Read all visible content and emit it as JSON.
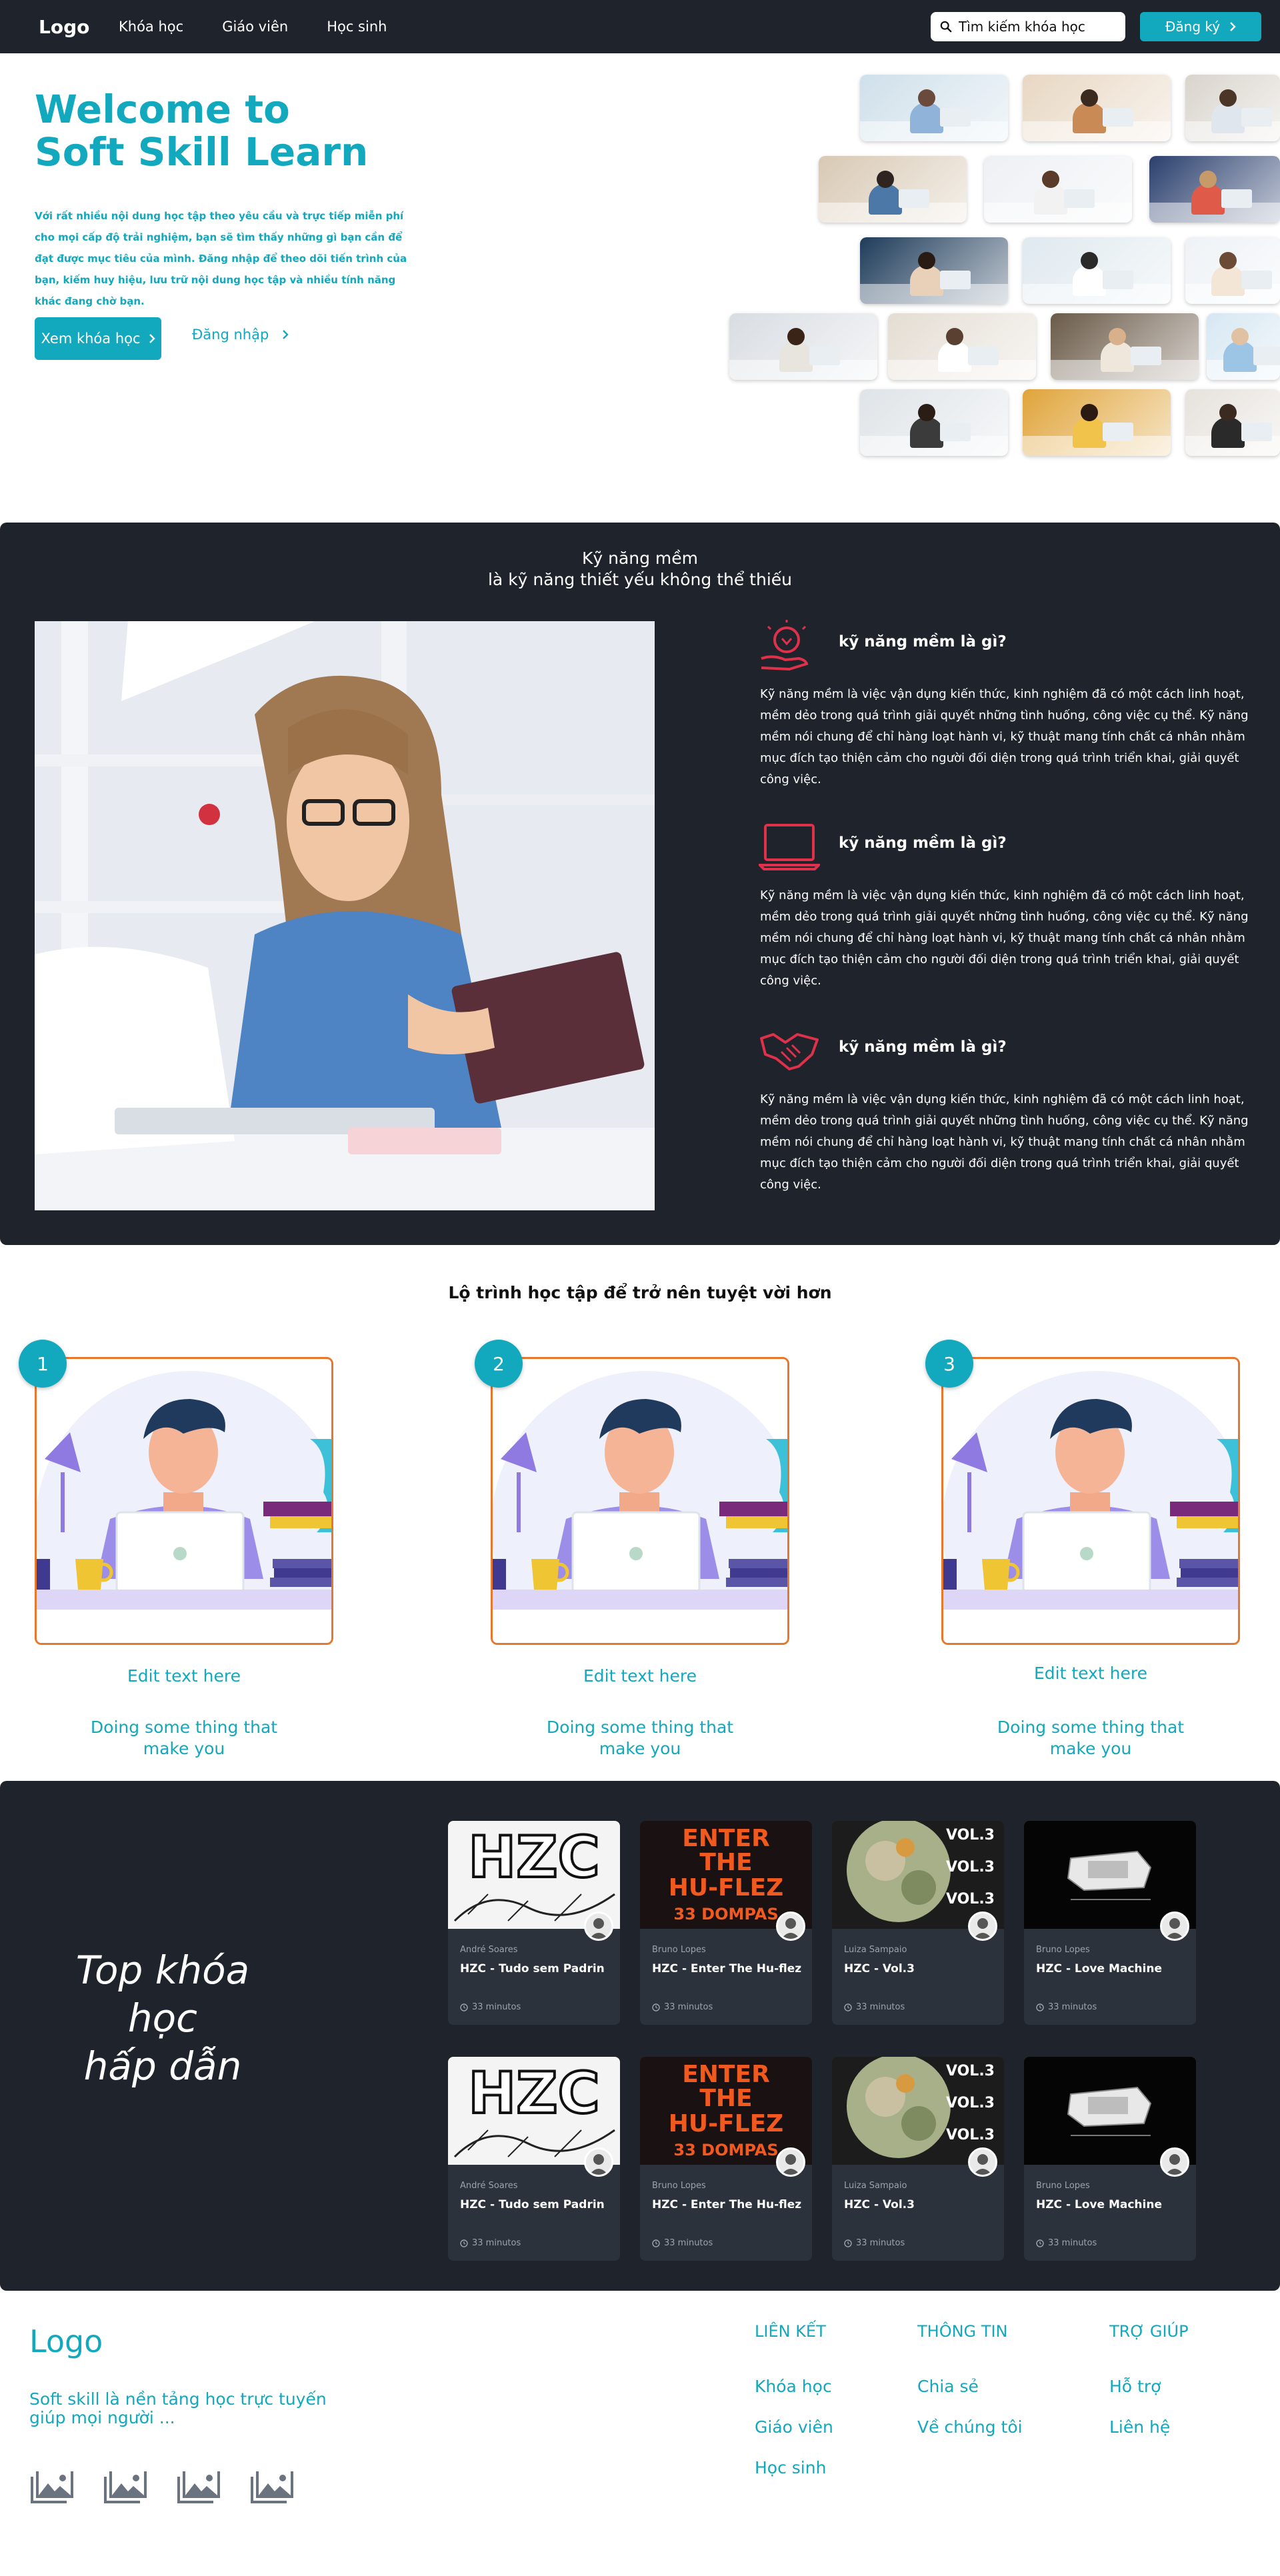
{
  "nav": {
    "logo": "Logo",
    "menu": [
      "Khóa học",
      "Giáo viên",
      "Học sinh"
    ],
    "search_value": "Tìm kiếm khóa học",
    "signup_label": "Đăng ký"
  },
  "hero": {
    "title_line1": "Welcome to",
    "title_line2": "Soft Skill Learn",
    "description": "Với rất nhiều nội dung học tập theo yêu cầu và trực tiếp miễn phí cho mọi cấp độ trải nghiệm, bạn sẽ tìm thấy những gì bạn cần để đạt được mục tiêu của mình. Đăng nhập để theo dõi tiến trình của bạn, kiếm huy hiệu, lưu trữ nội dung học tập và nhiều tính năng khác đang chờ bạn.",
    "primary_button": "Xem khóa học",
    "secondary_link": "Đăng nhập"
  },
  "softskill": {
    "heading_line1": "Kỹ năng mềm",
    "heading_line2": "là kỹ năng thiết yếu không thể thiếu",
    "features": [
      {
        "icon": "lightbulb-hand-icon",
        "title": "kỹ năng mềm là gì?",
        "desc": "Kỹ năng mềm là việc vận dụng kiến thức, kinh nghiệm đã có một cách linh hoạt, mềm dẻo trong quá trình giải quyết những tình huống, công việc cụ thể. Kỹ năng mềm nói chung để chỉ hàng loạt hành vi, kỹ thuật mang tính chất cá nhân nhằm mục đích tạo thiện cảm cho người đối diện trong quá trình triển khai, giải quyết công việc."
      },
      {
        "icon": "laptop-icon",
        "title": "kỹ năng mềm là gì?",
        "desc": "Kỹ năng mềm là việc vận dụng kiến thức, kinh nghiệm đã có một cách linh hoạt, mềm dẻo trong quá trình giải quyết những tình huống, công việc cụ thể. Kỹ năng mềm nói chung để chỉ hàng loạt hành vi, kỹ thuật mang tính chất cá nhân nhằm mục đích tạo thiện cảm cho người đối diện trong quá trình triển khai, giải quyết công việc."
      },
      {
        "icon": "handshake-icon",
        "title": "kỹ năng mềm là gì?",
        "desc": "Kỹ năng mềm là việc vận dụng kiến thức, kinh nghiệm đã có một cách linh hoạt, mềm dẻo trong quá trình giải quyết những tình huống, công việc cụ thể. Kỹ năng mềm nói chung để chỉ hàng loạt hành vi, kỹ thuật mang tính chất cá nhân nhằm mục đích tạo thiện cảm cho người đối diện trong quá trình triển khai, giải quyết công việc."
      }
    ]
  },
  "path": {
    "title": "Lộ trình học tập để trở nên tuyệt vời hơn",
    "steps": [
      {
        "number": "1",
        "edit": "Edit text here",
        "sub_line1": "Doing some thing that",
        "sub_line2": "make you"
      },
      {
        "number": "2",
        "edit": "Edit text here",
        "sub_line1": "Doing some thing that",
        "sub_line2": "make you"
      },
      {
        "number": "3",
        "edit": "Edit text here",
        "sub_line1": "Doing some thing that",
        "sub_line2": "make you"
      }
    ]
  },
  "courses": {
    "title_line1": "Top khóa",
    "title_line2": "học",
    "title_line3": "hấp dẫn",
    "items": [
      {
        "author": "André Soares",
        "title": "HZC - Tudo sem Padrin",
        "duration": "33 minutos",
        "cover": "hzc"
      },
      {
        "author": "Bruno Lopes",
        "title": "HZC - Enter The Hu-flez",
        "duration": "33 minutos",
        "cover": "enter"
      },
      {
        "author": "Luiza Sampaio",
        "title": "HZC - Vol.3",
        "duration": "33 minutos",
        "cover": "vol3"
      },
      {
        "author": "Bruno Lopes",
        "title": "HZC - Love Machine",
        "duration": "33 minutos",
        "cover": "love"
      },
      {
        "author": "André Soares",
        "title": "HZC - Tudo sem Padrin",
        "duration": "33 minutos",
        "cover": "hzc"
      },
      {
        "author": "Bruno Lopes",
        "title": "HZC - Enter The Hu-flez",
        "duration": "33 minutos",
        "cover": "enter"
      },
      {
        "author": "Luiza Sampaio",
        "title": "HZC - Vol.3",
        "duration": "33 minutos",
        "cover": "vol3"
      },
      {
        "author": "Bruno Lopes",
        "title": "HZC - Love Machine",
        "duration": "33 minutos",
        "cover": "love"
      }
    ],
    "cover_text": {
      "hzc": "HZC",
      "enter_line1": "ENTER",
      "enter_line2": "THE",
      "enter_line3": "HU-FLEZ",
      "enter_line4": "33 DOMPAS",
      "vol": "VOL.3"
    }
  },
  "footer": {
    "logo": "Logo",
    "desc_line1": "Soft skill là nền tảng học trực tuyến",
    "desc_line2": "giúp mọi người ...",
    "columns": [
      {
        "heading": "LIÊN KẾT",
        "links": [
          "Khóa học",
          "Giáo viên",
          "Học sinh"
        ]
      },
      {
        "heading": "THÔNG TIN",
        "links": [
          "Chia sẻ",
          "Về chúng tôi"
        ]
      },
      {
        "heading": "TRỢ GIÚP",
        "links": [
          "Hỗ trợ",
          "Liên hệ"
        ]
      }
    ],
    "social_icons": [
      "image-icon",
      "image-icon",
      "image-icon",
      "image-icon"
    ]
  },
  "colors": {
    "accent": "#12a8bd",
    "dark": "#1f232b",
    "icon_red": "#e0314b",
    "card_border": "#e8772e"
  }
}
